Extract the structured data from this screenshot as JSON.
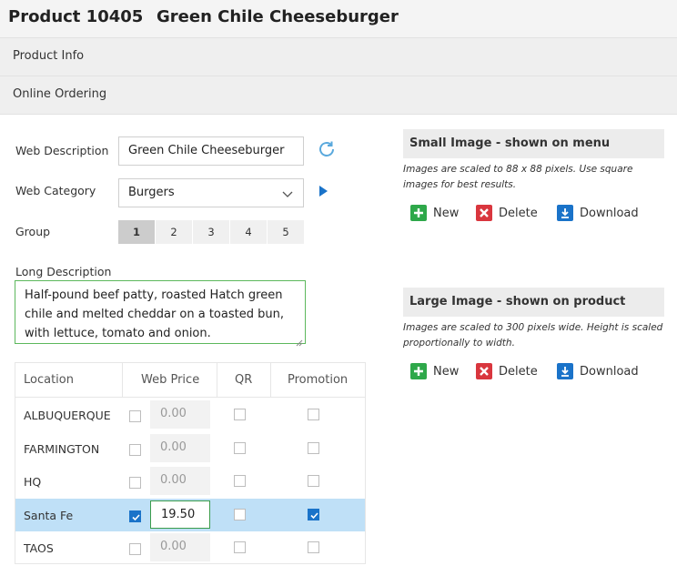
{
  "header": {
    "product_number": "Product 10405",
    "product_name": "Green Chile Cheeseburger"
  },
  "sections": {
    "product_info": "Product Info",
    "online_ordering": "Online Ordering"
  },
  "form": {
    "web_description_label": "Web Description",
    "web_description_value": "Green Chile Cheeseburger",
    "web_category_label": "Web Category",
    "web_category_value": "Burgers",
    "group_label": "Group",
    "groups": [
      "1",
      "2",
      "3",
      "4",
      "5"
    ],
    "selected_group": "1",
    "long_description_label": "Long Description",
    "long_description_value": "Half-pound beef patty, roasted Hatch green chile and melted cheddar on a toasted bun, with lettuce, tomato and onion."
  },
  "grid": {
    "columns": [
      "Location",
      "Web Price",
      "QR",
      "Promotion"
    ],
    "rows": [
      {
        "location": "ALBUQUERQUE",
        "web_checked": false,
        "price": "0.00",
        "qr": false,
        "promotion": false,
        "selected": false
      },
      {
        "location": "FARMINGTON",
        "web_checked": false,
        "price": "0.00",
        "qr": false,
        "promotion": false,
        "selected": false
      },
      {
        "location": "HQ",
        "web_checked": false,
        "price": "0.00",
        "qr": false,
        "promotion": false,
        "selected": false
      },
      {
        "location": "Santa Fe",
        "web_checked": true,
        "price": "19.50",
        "qr": false,
        "promotion": true,
        "selected": true
      },
      {
        "location": "TAOS",
        "web_checked": false,
        "price": "0.00",
        "qr": false,
        "promotion": false,
        "selected": false
      }
    ]
  },
  "small_image": {
    "title": "Small Image - shown on menu",
    "note": "Images are scaled to 88 x 88 pixels. Use square images for best results.",
    "new_label": "New",
    "delete_label": "Delete",
    "download_label": "Download"
  },
  "large_image": {
    "title": "Large Image - shown on product",
    "note": "Images are scaled to 300 pixels wide. Height is scaled proportionally to width.",
    "new_label": "New",
    "delete_label": "Delete",
    "download_label": "Download"
  },
  "colors": {
    "accent_blue": "#1a73c9",
    "green": "#2ea84a",
    "red": "#d9363e",
    "selected_row": "#bfe0f7"
  }
}
